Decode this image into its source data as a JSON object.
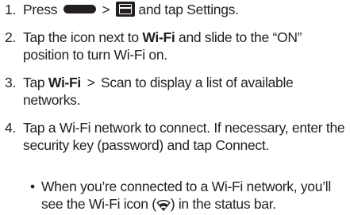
{
  "steps": [
    {
      "number": "1.",
      "part1": "Press",
      "separator": ">",
      "part2": "and tap",
      "settings": "Settings."
    },
    {
      "number": "2.",
      "part1": "Tap the icon next to",
      "wifi": "Wi-Fi",
      "part2": "and slide to the “ON” position to turn Wi-Fi on."
    },
    {
      "number": "3.",
      "part1": "Tap",
      "wifi": "Wi-Fi",
      "separator": ">",
      "scan": "Scan",
      "part2": "to display a list of available networks."
    },
    {
      "number": "4.",
      "part1": "Tap a Wi-Fi network to connect. If necessary, enter the security key (password) and tap",
      "connect": "Connect."
    }
  ],
  "note": {
    "bullet": "•",
    "part1": "When you’re connected to a Wi-Fi network, you’ll see the Wi-Fi icon (",
    "part2": ") in the status bar."
  },
  "icons": {
    "home_key": "home-key-icon",
    "menu_key": "menu-key-icon",
    "wifi": "wifi-icon"
  },
  "colors": {
    "text": "#231f20",
    "background": "#ffffff"
  }
}
